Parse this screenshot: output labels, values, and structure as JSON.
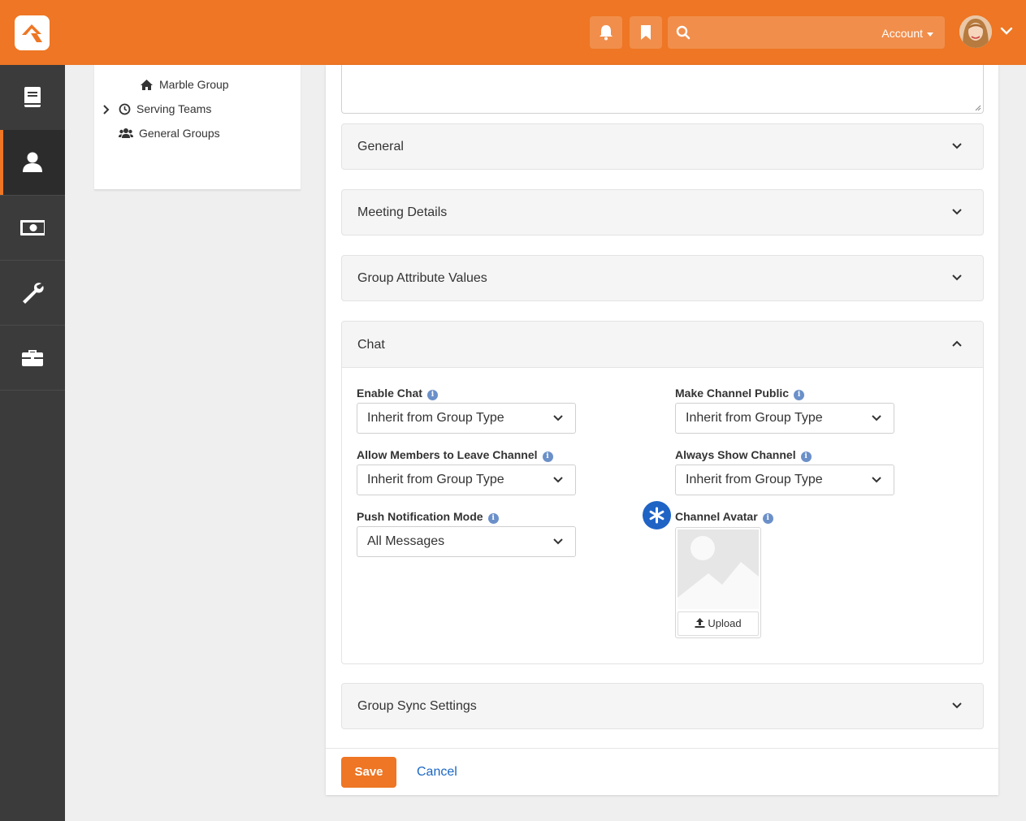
{
  "topbar": {
    "account_label": "Account",
    "search_placeholder": ""
  },
  "tree": {
    "items": [
      {
        "label": "Marble Group",
        "icon": "home-icon"
      },
      {
        "label": "Serving Teams",
        "icon": "clock-icon"
      },
      {
        "label": "General Groups",
        "icon": "users-icon"
      }
    ]
  },
  "panels": {
    "general": "General",
    "meeting_details": "Meeting Details",
    "group_attribute_values": "Group Attribute Values",
    "chat": "Chat",
    "group_sync_settings": "Group Sync Settings"
  },
  "chat": {
    "enable_chat": {
      "label": "Enable Chat",
      "value": "Inherit from Group Type"
    },
    "make_channel_public": {
      "label": "Make Channel Public",
      "value": "Inherit from Group Type"
    },
    "allow_members_leave": {
      "label": "Allow Members to Leave Channel",
      "value": "Inherit from Group Type"
    },
    "always_show_channel": {
      "label": "Always Show Channel",
      "value": "Inherit from Group Type"
    },
    "push_notification_mode": {
      "label": "Push Notification Mode",
      "value": "All Messages"
    },
    "channel_avatar": {
      "label": "Channel Avatar",
      "upload_label": "Upload"
    }
  },
  "actions": {
    "save": "Save",
    "cancel": "Cancel"
  },
  "colors": {
    "brand": "#ee7624",
    "sidebar": "#3b3b3b",
    "link": "#1a67c4",
    "badge": "#1f63c5"
  }
}
